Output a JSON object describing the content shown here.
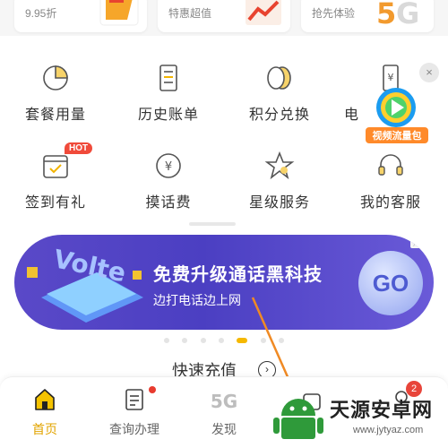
{
  "promo_cards": [
    {
      "text": "9.95折"
    },
    {
      "text": "特惠超值"
    },
    {
      "text": "抢先体验"
    }
  ],
  "grid": [
    {
      "label": "套餐用量",
      "icon": "pie-chart-icon"
    },
    {
      "label": "历史账单",
      "icon": "bill-icon"
    },
    {
      "label": "积分兑换",
      "icon": "coins-icon"
    },
    {
      "label": "电",
      "icon": "yuan-phone-icon"
    },
    {
      "label": "签到有礼",
      "icon": "calendar-check-icon",
      "badge": "HOT"
    },
    {
      "label": "摸话费",
      "icon": "yuan-circle-icon"
    },
    {
      "label": "星级服务",
      "icon": "star-icon"
    },
    {
      "label": "我的客服",
      "icon": "headset-icon"
    }
  ],
  "floating": {
    "label": "视频流量包",
    "close": "×"
  },
  "banner": {
    "art_text": "Volte",
    "title": "免费升级通话黑科技",
    "subtitle": "边打电话边上网",
    "go": "GO",
    "ad": "广告"
  },
  "quick_recharge": {
    "label": "快速充值",
    "arrow": "›"
  },
  "bottom_nav": [
    {
      "label": "首页",
      "active": true
    },
    {
      "label": "查询办理",
      "dot": true
    },
    {
      "label": "发现",
      "icon_text": "5G"
    },
    {
      "label": ""
    },
    {
      "label": "",
      "count": "2"
    }
  ],
  "watermark": {
    "title": "天源安卓网",
    "url": "www.jytyaz.com"
  },
  "colors": {
    "accent": "#f5b800",
    "banner": "#4b3fc2",
    "badge_red": "#e83b2f"
  }
}
